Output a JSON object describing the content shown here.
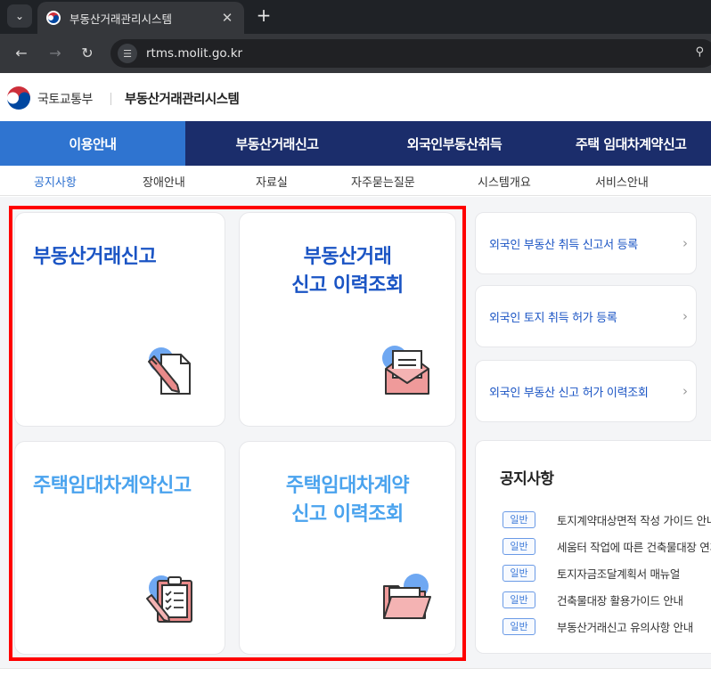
{
  "browser": {
    "tab_title": "부동산거래관리시스템",
    "url": "rtms.molit.go.kr"
  },
  "header": {
    "org_name": "국토교통부",
    "system_title": "부동산거래관리시스템"
  },
  "main_nav": [
    {
      "label": "이용안내",
      "active": true
    },
    {
      "label": "부동산거래신고",
      "active": false
    },
    {
      "label": "외국인부동산취득",
      "active": false
    },
    {
      "label": "주택 임대차계약신고",
      "active": false
    }
  ],
  "sub_nav": [
    {
      "label": "공지사항",
      "active": true
    },
    {
      "label": "장애안내",
      "active": false
    },
    {
      "label": "자료실",
      "active": false
    },
    {
      "label": "자주묻는질문",
      "active": false
    },
    {
      "label": "시스템개요",
      "active": false
    },
    {
      "label": "서비스안내",
      "active": false
    }
  ],
  "cards": [
    {
      "title": "부동산거래신고",
      "icon": "document-pen-icon"
    },
    {
      "title": "부동산거래\n신고 이력조회",
      "icon": "envelope-letter-icon"
    },
    {
      "title": "주택임대차계약신고",
      "icon": "clipboard-checklist-icon"
    },
    {
      "title": "주택임대차계약\n신고 이력조회",
      "icon": "open-folder-icon"
    }
  ],
  "quick_links": [
    {
      "label": "외국인 부동산 취득 신고서 등록"
    },
    {
      "label": "외국인 토지 취득 허가 등록"
    },
    {
      "label": "외국인 부동산 신고 허가 이력조회"
    }
  ],
  "notices": {
    "heading": "공지사항",
    "items": [
      {
        "badge": "일반",
        "text": "토지계약대상면적 작성 가이드 안내"
      },
      {
        "badge": "일반",
        "text": "세움터 작업에 따른 건축물대장 연계 안내"
      },
      {
        "badge": "일반",
        "text": "토지자금조달계획서 매뉴얼"
      },
      {
        "badge": "일반",
        "text": "건축물대장 활용가이드 안내"
      },
      {
        "badge": "일반",
        "text": "부동산거래신고 유의사항 안내"
      }
    ]
  },
  "colors": {
    "nav_bg": "#1b2d6b",
    "nav_active": "#2f74d0",
    "card_title_dark": "#1a54c4",
    "card_title_light": "#4aa3ee",
    "highlight": "#ff0000"
  }
}
